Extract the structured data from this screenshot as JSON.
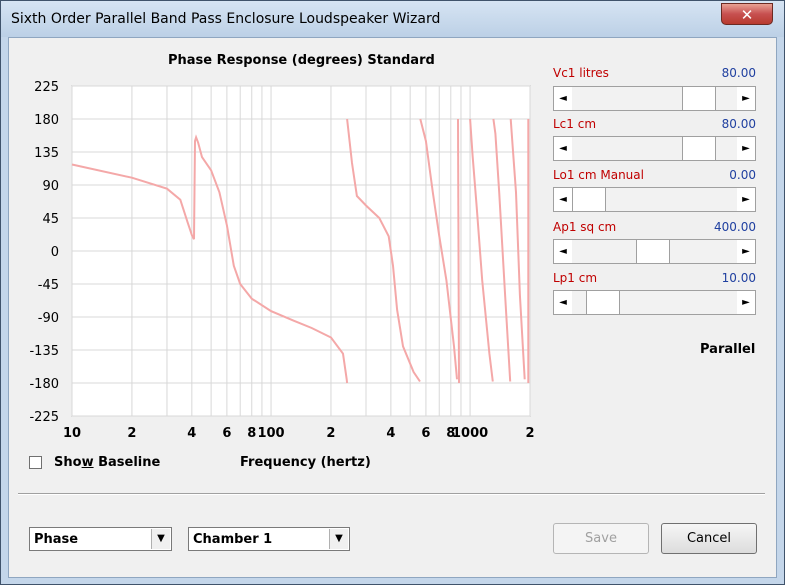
{
  "window": {
    "title": "Sixth Order Parallel Band Pass Enclosure Loudspeaker Wizard",
    "close_glyph": "✕"
  },
  "chart": {
    "title": "Phase Response (degrees)   Standard",
    "xlabel": "Frequency (hertz)",
    "y_tick_labels": [
      "225",
      "180",
      "135",
      "90",
      "45",
      "0",
      "-45",
      "-90",
      "-135",
      "-180",
      "-225"
    ],
    "x_tick_labels": [
      "10",
      "2",
      "4",
      "6",
      "8",
      "100",
      "2",
      "4",
      "6",
      "8",
      "1000",
      "2"
    ],
    "line_color": "#f4a8a8"
  },
  "chart_data": {
    "type": "line",
    "xscale": "log",
    "xlim": [
      10,
      2000
    ],
    "ylim": [
      -225,
      225
    ],
    "grid": true,
    "series": [
      {
        "segments": [
          [
            [
              10,
              118
            ],
            [
              20,
              100
            ],
            [
              30,
              85
            ],
            [
              35,
              70
            ],
            [
              38,
              40
            ],
            [
              40,
              22
            ],
            [
              41,
              16
            ]
          ],
          [
            [
              41,
              16
            ],
            [
              41.5,
              150
            ],
            [
              42,
              155
            ],
            [
              43,
              148
            ],
            [
              45,
              128
            ],
            [
              50,
              110
            ],
            [
              55,
              80
            ],
            [
              60,
              35
            ],
            [
              65,
              -20
            ],
            [
              70,
              -45
            ],
            [
              80,
              -65
            ],
            [
              100,
              -82
            ],
            [
              130,
              -95
            ],
            [
              160,
              -105
            ],
            [
              200,
              -118
            ],
            [
              230,
              -140
            ],
            [
              240,
              -175
            ],
            [
              241,
              -180
            ]
          ],
          [
            [
              241,
              180
            ],
            [
              255,
              120
            ],
            [
              270,
              75
            ],
            [
              300,
              62
            ],
            [
              350,
              45
            ],
            [
              390,
              20
            ],
            [
              410,
              -20
            ],
            [
              430,
              -80
            ],
            [
              460,
              -130
            ],
            [
              520,
              -165
            ],
            [
              560,
              -178
            ]
          ],
          [
            [
              562,
              180
            ],
            [
              600,
              150
            ],
            [
              650,
              80
            ],
            [
              700,
              20
            ],
            [
              760,
              -40
            ],
            [
              830,
              -130
            ],
            [
              860,
              -175
            ]
          ],
          [
            [
              870,
              180
            ],
            [
              880,
              -180
            ]
          ],
          [
            [
              1000,
              180
            ],
            [
              1030,
              130
            ],
            [
              1080,
              60
            ],
            [
              1150,
              -40
            ],
            [
              1250,
              -140
            ],
            [
              1300,
              -178
            ]
          ],
          [
            [
              1310,
              180
            ],
            [
              1340,
              160
            ],
            [
              1400,
              80
            ],
            [
              1500,
              -60
            ],
            [
              1590,
              -178
            ]
          ],
          [
            [
              1600,
              180
            ],
            [
              1640,
              140
            ],
            [
              1700,
              80
            ],
            [
              1780,
              -60
            ],
            [
              1880,
              -175
            ]
          ],
          [
            [
              1960,
              180
            ],
            [
              1962,
              -180
            ]
          ]
        ]
      }
    ]
  },
  "controls": [
    {
      "label": "Vc1  litres",
      "value": "80.00",
      "position": 0.84
    },
    {
      "label": "Lc1  cm",
      "value": "80.00",
      "position": 0.84
    },
    {
      "label": "Lo1  cm Manual",
      "value": "0.00",
      "position": 0.0
    },
    {
      "label": "Ap1  sq cm",
      "value": "400.00",
      "position": 0.49
    },
    {
      "label": "Lp1  cm",
      "value": "10.00",
      "position": 0.11
    }
  ],
  "scroll_left_glyph": "◄",
  "scroll_right_glyph": "►",
  "dropdown_glyph": "▼",
  "mode_label": "Parallel",
  "show_baseline": {
    "label_pre": "Sho",
    "label_accel": "w",
    "label_post": " Baseline",
    "checked": false
  },
  "combo_left": {
    "value": "Phase"
  },
  "combo_right": {
    "value": "Chamber 1"
  },
  "buttons": {
    "save": "Save",
    "cancel": "Cancel"
  }
}
